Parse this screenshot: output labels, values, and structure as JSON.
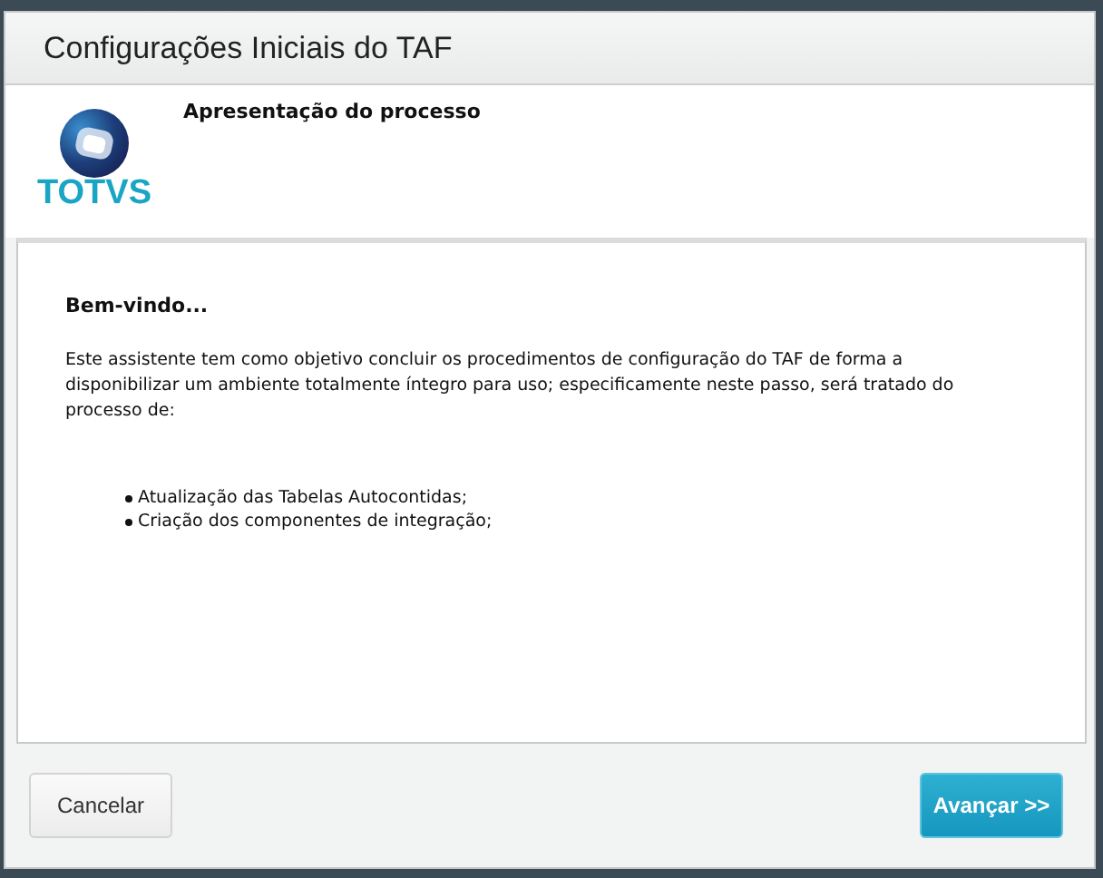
{
  "window": {
    "title": "Configurações Iniciais do TAF"
  },
  "header": {
    "logo_text": "TOTVS",
    "step_title": "Apresentação do processo"
  },
  "content": {
    "heading": "Bem-vindo...",
    "paragraph": "Este assistente tem como objetivo concluir os procedimentos de configuração do TAF de forma a disponibilizar um ambiente totalmente íntegro para uso; especificamente neste passo, será tratado do processo de:",
    "bullets": [
      "Atualização das Tabelas Autocontidas;",
      "Criação dos componentes de integração;"
    ]
  },
  "buttons": [
    {
      "label": "Cancelar",
      "kind": "secondary"
    },
    {
      "label": "Avançar >>",
      "kind": "primary"
    }
  ]
}
